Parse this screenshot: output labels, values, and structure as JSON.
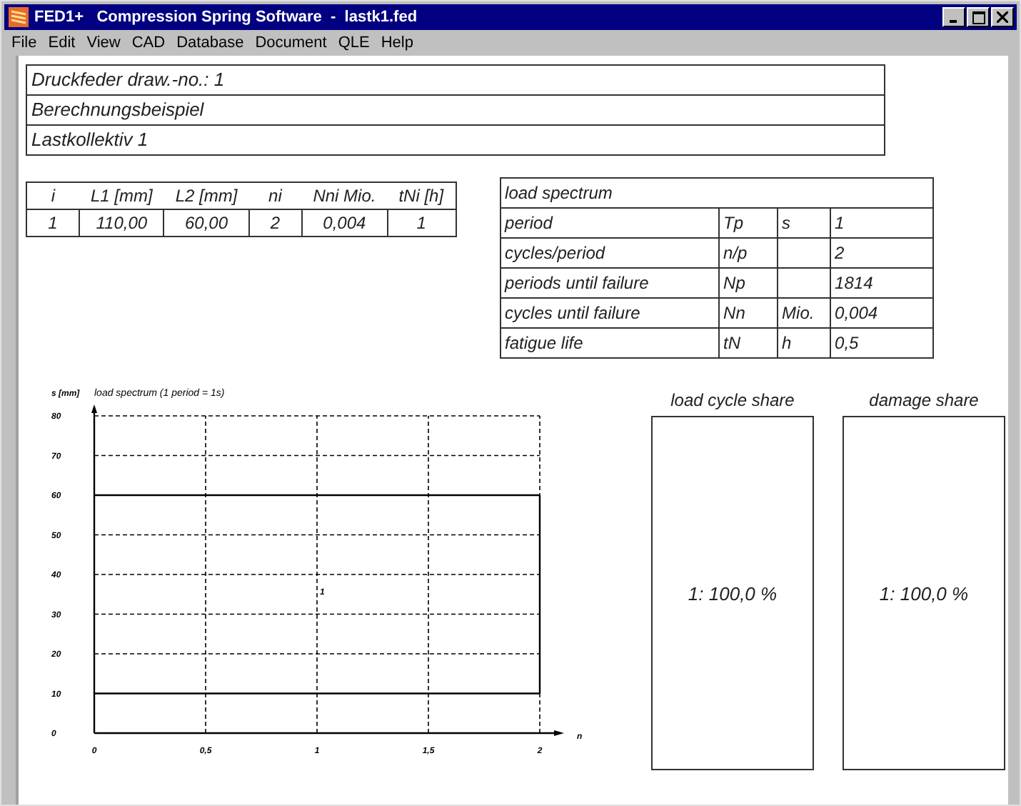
{
  "window": {
    "title": "FED1+   Compression Spring Software  -  lastk1.fed"
  },
  "menu": [
    "File",
    "Edit",
    "View",
    "CAD",
    "Database",
    "Document",
    "QLE",
    "Help"
  ],
  "header_lines": [
    "Druckfeder   draw.-no.: 1",
    "Berechnungsbeispiel",
    "Lastkollektiv 1"
  ],
  "cycle_table": {
    "columns": [
      "i",
      "L1 [mm]",
      "L2 [mm]",
      "ni",
      "Nni Mio.",
      "tNi [h]"
    ],
    "rows": [
      [
        "1",
        "110,00",
        "60,00",
        "2",
        "0,004",
        "1"
      ]
    ]
  },
  "load_spectrum": {
    "title": "load spectrum",
    "rows": [
      [
        "period",
        "Tp",
        "s",
        "1"
      ],
      [
        "cycles/period",
        "n/p",
        "",
        "2"
      ],
      [
        "periods until failure",
        "Np",
        "",
        "1814"
      ],
      [
        "cycles until failure",
        "Nn",
        "Mio.",
        "0,004"
      ],
      [
        "fatigue life",
        "tN",
        "h",
        "0,5"
      ]
    ]
  },
  "chart": {
    "chart_data": {
      "type": "line",
      "title": "load spectrum  (1 period = 1s)",
      "xlabel": "n",
      "ylabel": "s [mm]",
      "x": [
        0,
        2
      ],
      "series": [
        {
          "color": "#000000",
          "line_style": "solid",
          "values": [
            60,
            60
          ]
        },
        {
          "color": "#000000",
          "line_style": "solid",
          "values": [
            10,
            10
          ]
        }
      ],
      "xlim": [
        0,
        2
      ],
      "ylim": [
        0,
        80
      ],
      "xticks": [
        0,
        {
          "value": 0.5,
          "label": "0,5"
        },
        1,
        {
          "value": 1.5,
          "label": "1,5"
        },
        2
      ],
      "yticks": [
        0,
        10,
        20,
        30,
        40,
        50,
        60,
        70,
        80
      ],
      "annotations": [
        "1"
      ]
    }
  },
  "shares": [
    {
      "title": "load cycle share",
      "value": "1: 100,0 %"
    },
    {
      "title": "damage share",
      "value": "1: 100,0 %"
    }
  ]
}
